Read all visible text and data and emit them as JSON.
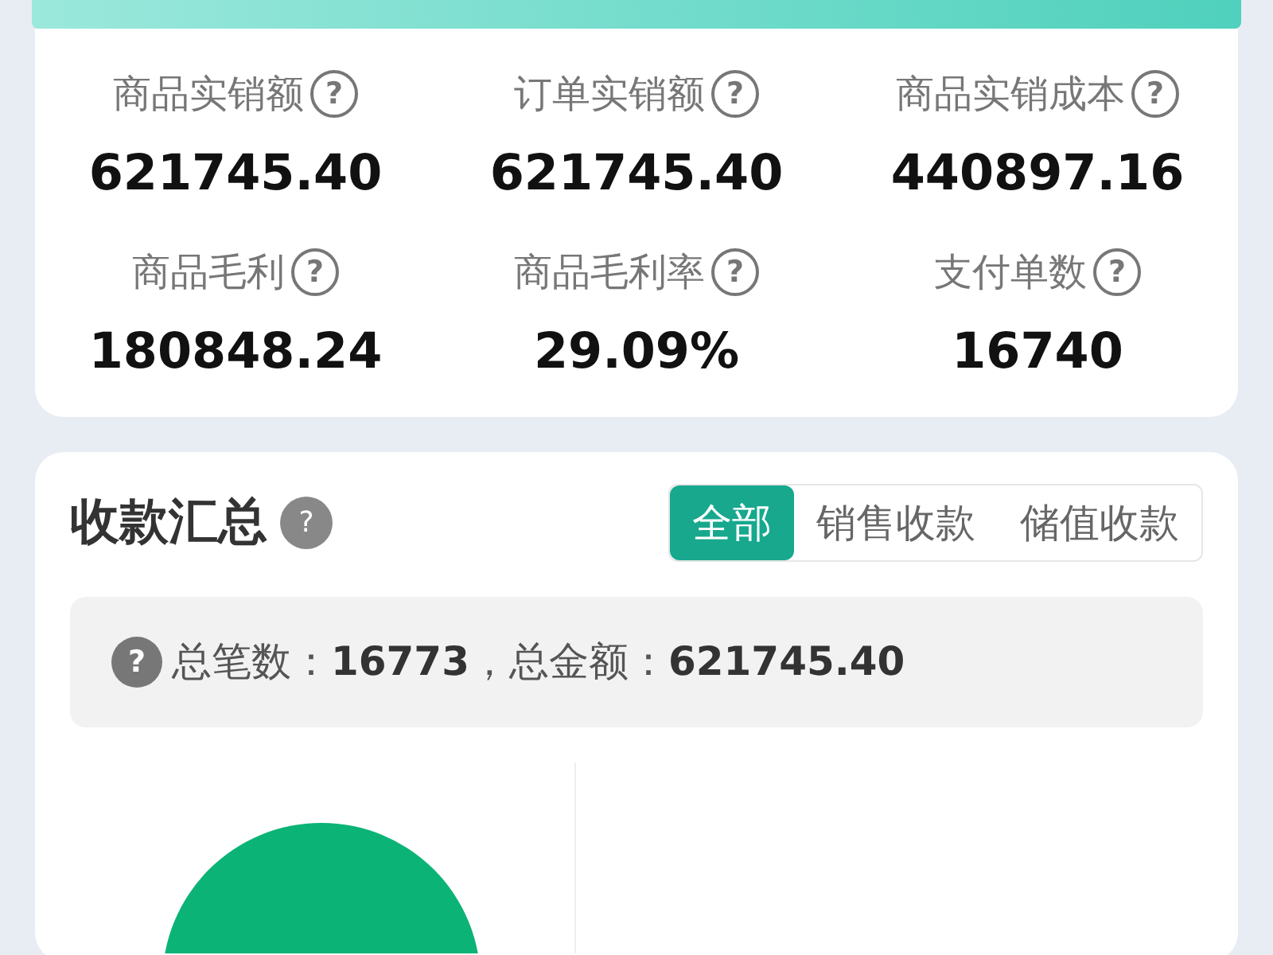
{
  "metrics": [
    {
      "label": "商品实销额",
      "help_icon": "?",
      "value": "621745.40"
    },
    {
      "label": "订单实销额",
      "help_icon": "?",
      "value": "621745.40"
    },
    {
      "label": "商品实销成本",
      "help_icon": "?",
      "value": "440897.16"
    },
    {
      "label": "商品毛利",
      "help_icon": "?",
      "value": "180848.24"
    },
    {
      "label": "商品毛利率",
      "help_icon": "?",
      "value": "29.09%"
    },
    {
      "label": "支付单数",
      "help_icon": "?",
      "value": "16740"
    }
  ],
  "collection_summary": {
    "title": "收款汇总",
    "help_icon": "?",
    "tabs": [
      {
        "label": "全部",
        "selected": true
      },
      {
        "label": "销售收款",
        "selected": false
      },
      {
        "label": "储值收款",
        "selected": false
      }
    ],
    "summary_help_icon": "?",
    "summary": "总笔数：**16773**，总金额：**621745.40**"
  }
}
